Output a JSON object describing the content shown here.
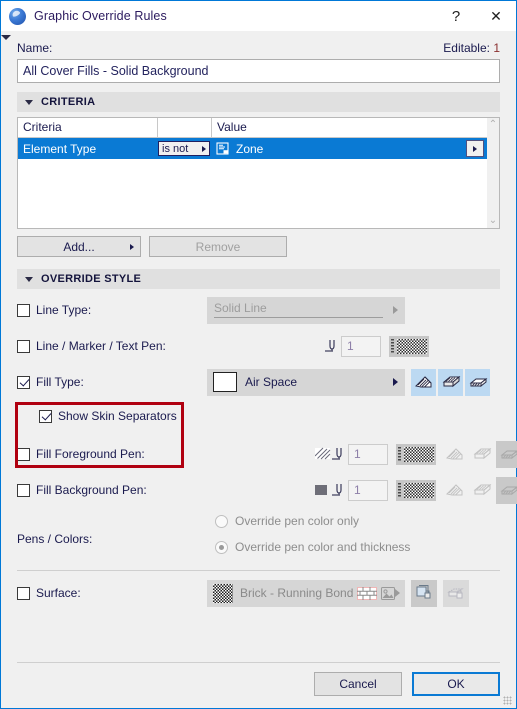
{
  "window": {
    "title": "Graphic Override Rules",
    "logo_icon": "archicad-logo-icon",
    "help_label": "?",
    "close_label": "✕"
  },
  "name_row": {
    "label": "Name:",
    "editable_label": "Editable:",
    "editable_count": "1",
    "value": "All Cover Fills - Solid Background"
  },
  "criteria_section": {
    "header": "CRITERIA",
    "columns": [
      "Criteria",
      "",
      "Value"
    ],
    "rows": [
      {
        "criteria": "Element Type",
        "operator": "is not",
        "value": "Zone",
        "value_icon": "zone-icon",
        "selected": true
      }
    ],
    "add_button": "Add...",
    "remove_button": "Remove"
  },
  "override_section": {
    "header": "OVERRIDE STYLE",
    "line_type": {
      "label": "Line Type:",
      "checked": false,
      "value": "Solid Line",
      "enabled": false
    },
    "line_marker_text_pen": {
      "label": "Line / Marker / Text Pen:",
      "checked": false,
      "pen_number": "1",
      "enabled": false
    },
    "fill_type": {
      "label": "Fill Type:",
      "checked": true,
      "value": "Air Space",
      "enabled": true,
      "category_buttons": [
        {
          "name": "cut-fill-icon",
          "active": true
        },
        {
          "name": "cover-fill-icon",
          "active": true
        },
        {
          "name": "drafting-fill-icon",
          "active": true
        }
      ]
    },
    "show_skin_separators": {
      "label": "Show Skin Separators",
      "checked": true
    },
    "fill_foreground_pen": {
      "label": "Fill Foreground Pen:",
      "checked": false,
      "pen_number": "1",
      "enabled": false
    },
    "fill_background_pen": {
      "label": "Fill Background Pen:",
      "checked": false,
      "pen_number": "1",
      "enabled": false
    },
    "pens_colors": {
      "label": "Pens / Colors:",
      "options": [
        {
          "label": "Override pen color only",
          "selected": false
        },
        {
          "label": "Override pen color and thickness",
          "selected": true
        }
      ]
    },
    "surface": {
      "label": "Surface:",
      "checked": false,
      "value": "Brick - Running Bond",
      "enabled": false
    }
  },
  "footer": {
    "cancel_label": "Cancel",
    "ok_label": "OK"
  },
  "colors": {
    "accent": "#0a7ad4",
    "annotation": "#b00010",
    "window_bg": "#f0f0f0",
    "text": "#1a1a4e"
  }
}
